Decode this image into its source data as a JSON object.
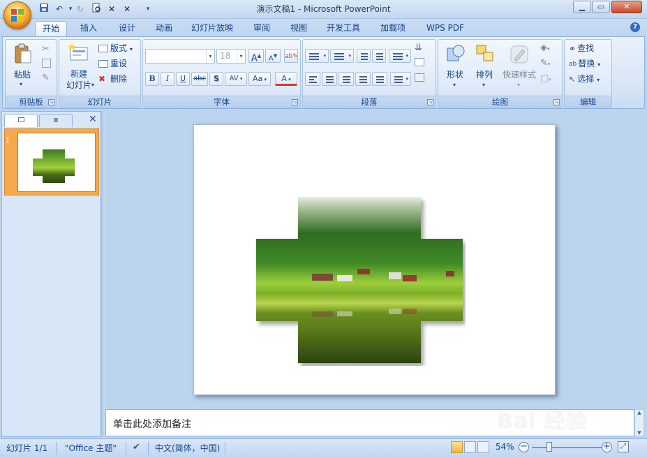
{
  "app": {
    "title": "演示文稿1 - Microsoft PowerPoint"
  },
  "tabs": [
    "开始",
    "插入",
    "设计",
    "动画",
    "幻灯片放映",
    "审阅",
    "视图",
    "开发工具",
    "加载项",
    "WPS PDF"
  ],
  "ribbon": {
    "clipboard": {
      "label": "剪贴板",
      "paste": "粘贴"
    },
    "slides": {
      "label": "幻灯片",
      "new_slide": "新建",
      "new_slide_2": "幻灯片",
      "layout": "版式",
      "reset": "重设",
      "delete": "删除"
    },
    "font": {
      "label": "字体",
      "font_size": "18",
      "bold": "B",
      "italic": "I",
      "underline": "U",
      "strike": "abc",
      "shadow": "S",
      "spacing": "AV",
      "case": "Aa",
      "grow": "A",
      "shrink": "A",
      "color": "A"
    },
    "paragraph": {
      "label": "段落"
    },
    "drawing": {
      "label": "绘图",
      "shapes": "形状",
      "arrange": "排列",
      "quick_styles": "快速样式"
    },
    "editing": {
      "label": "编辑",
      "find": "查找",
      "replace": "替换",
      "select": "选择"
    }
  },
  "slide_pane": {
    "slide_number": "1"
  },
  "notes": {
    "placeholder": "单击此处添加备注"
  },
  "status": {
    "slide": "幻灯片 1/1",
    "theme": "\"Office 主题\"",
    "language": "中文(简体，中国)",
    "zoom": "54%"
  },
  "watermark": {
    "text": "Bai  经验",
    "sub": "jingyan.baidu.com"
  },
  "colors": {
    "ribbon_bg": "#dbe7f7",
    "accent": "#15428b",
    "thumb_selected": "#f5a94a"
  }
}
